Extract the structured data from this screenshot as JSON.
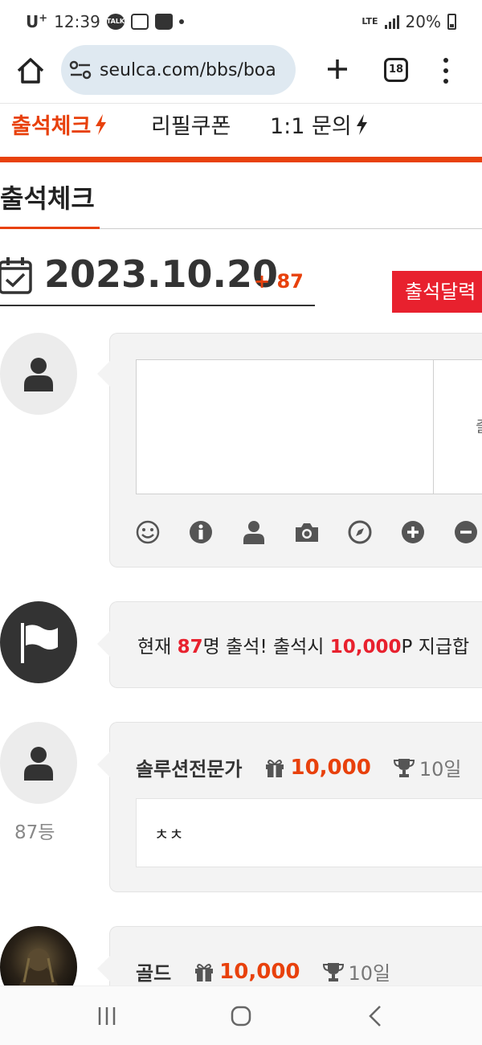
{
  "status_bar": {
    "carrier": "U",
    "carrier_sup": "+",
    "time": "12:39",
    "lte": "LTE",
    "battery": "20%",
    "talk_icon_text": "TALK"
  },
  "browser": {
    "url": "seulca.com/bbs/boa",
    "tab_count": "18"
  },
  "nav": {
    "items": [
      "출석체크",
      "리필쿠폰",
      "1:1 문의"
    ],
    "active_index": 0
  },
  "page": {
    "title": "출석체크"
  },
  "date_row": {
    "date": "2023.10.20",
    "count": "+ 87",
    "calendar_button": "출석달력"
  },
  "form": {
    "side_text": "출",
    "tools": [
      "smile-icon",
      "info-icon",
      "user-icon",
      "camera-icon",
      "compass-icon",
      "plus-circle-icon",
      "minus-circle-icon"
    ]
  },
  "notice": {
    "prefix": "현재 ",
    "count": "87",
    "mid": "명 출석! 출석시 ",
    "points": "10,000",
    "suffix": "P 지급합"
  },
  "entries": [
    {
      "name": "솔루션전문가",
      "points": "10,000",
      "days": "10일",
      "comment": "ㅊㅊ",
      "rank": "87등"
    },
    {
      "name": "골드",
      "points": "10,000",
      "days": "10일"
    }
  ],
  "colors": {
    "accent": "#e8410c",
    "red": "#e8212e",
    "panel": "#f3f3f3",
    "url_bg": "#dfe9f1"
  }
}
